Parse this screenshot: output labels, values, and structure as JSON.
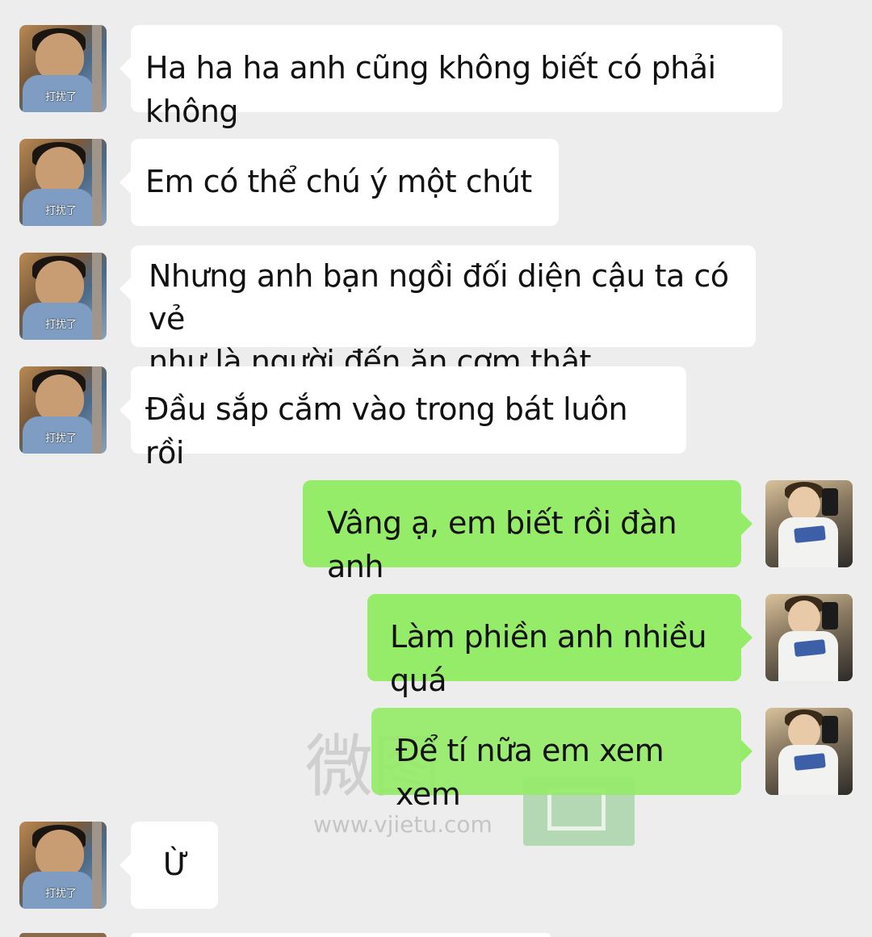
{
  "conversation": {
    "messages": [
      {
        "sender": "other",
        "text": "Ha ha ha anh cũng không biết có phải không",
        "avatar_caption": "打扰了"
      },
      {
        "sender": "other",
        "text": "Em có thể chú ý một chút",
        "avatar_caption": "打扰了"
      },
      {
        "sender": "other",
        "text": "Nhưng anh bạn ngồi đối diện cậu ta có vẻ\nnhư là người đến ăn cơm thật",
        "avatar_caption": "打扰了"
      },
      {
        "sender": "other",
        "text": "Đầu sắp cắm vào trong bát luôn rồi",
        "avatar_caption": "打扰了"
      },
      {
        "sender": "self",
        "text": "Vâng ạ, em biết rồi đàn anh"
      },
      {
        "sender": "self",
        "text": "Làm phiền anh nhiều quá"
      },
      {
        "sender": "self",
        "text": "Để tí nữa em xem xem"
      },
      {
        "sender": "other",
        "text": "Ừ",
        "avatar_caption": "打扰了"
      }
    ]
  },
  "watermark": {
    "brand": "微图",
    "url": "www.vjietu.com"
  },
  "colors": {
    "background": "#ededed",
    "bubble_other": "#ffffff",
    "bubble_self": "#95ec69",
    "text": "#111111"
  },
  "icons": {
    "avatar_other": "avatar-boy-photo",
    "avatar_self": "avatar-selfie-photo"
  }
}
